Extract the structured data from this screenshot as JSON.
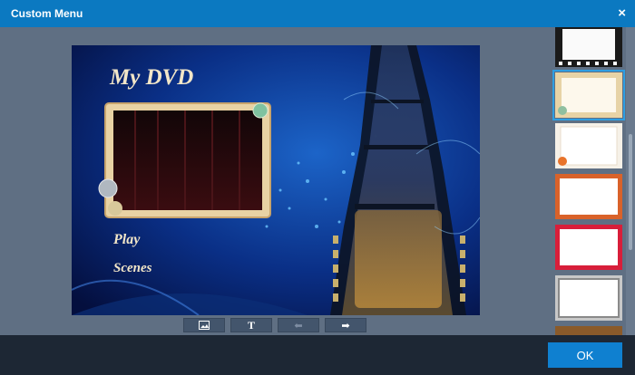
{
  "window": {
    "title": "Custom Menu",
    "close_icon": "×"
  },
  "menu_preview": {
    "title": "My DVD",
    "items": [
      "Play",
      "Scenes"
    ]
  },
  "toolbar": [
    {
      "name": "background-image-button",
      "icon": "image-icon",
      "label": "",
      "enabled": true
    },
    {
      "name": "add-text-button",
      "icon": "text-icon",
      "label": "T",
      "enabled": true
    },
    {
      "name": "back-button",
      "icon": "arrow-left-icon",
      "label": "⬅",
      "enabled": false
    },
    {
      "name": "forward-button",
      "icon": "arrow-right-icon",
      "label": "➡",
      "enabled": true
    }
  ],
  "templates": [
    {
      "name": "filmstrip-frame",
      "selected": false
    },
    {
      "name": "vintage-shell-frame",
      "selected": true
    },
    {
      "name": "orange-flower-frame",
      "selected": false
    },
    {
      "name": "orange-pattern-frame",
      "selected": false
    },
    {
      "name": "red-frame",
      "selected": false
    },
    {
      "name": "silver-frame",
      "selected": false
    },
    {
      "name": "wood-frame",
      "selected": false
    }
  ],
  "footer": {
    "ok_label": "OK"
  },
  "colors": {
    "titlebar": "#0b79c1",
    "footer": "#1d2734",
    "accent": "#0f80d0",
    "background": "#5f6f83"
  }
}
